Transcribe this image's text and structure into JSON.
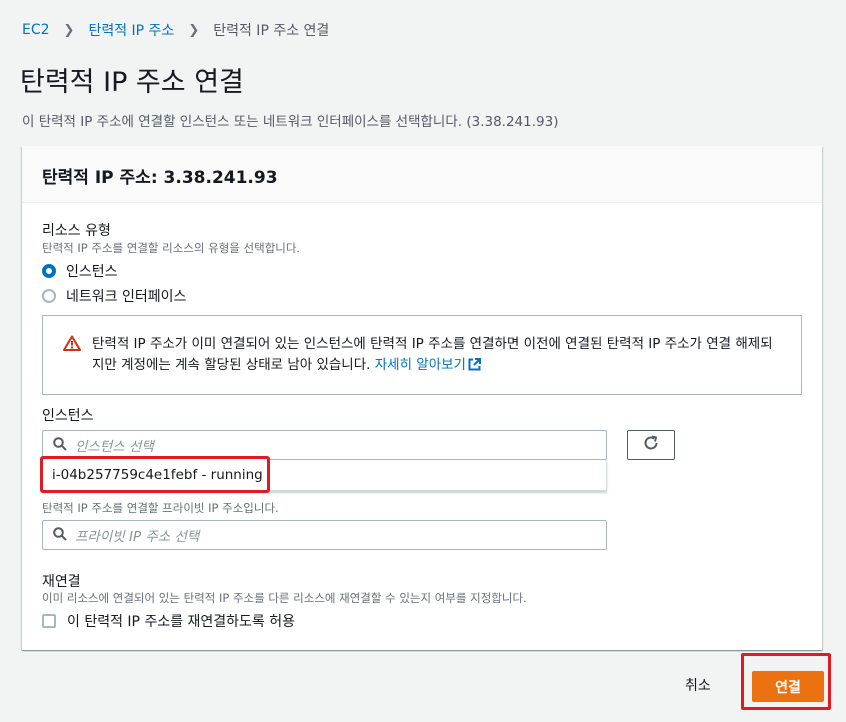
{
  "breadcrumb": {
    "items": [
      "EC2",
      "탄력적 IP 주소",
      "탄력적 IP 주소 연결"
    ]
  },
  "page": {
    "title": "탄력적 IP 주소 연결",
    "description": "이 탄력적 IP 주소에 연결할 인스턴스 또는 네트워크 인터페이스를 선택합니다. (3.38.241.93)"
  },
  "panel": {
    "header": "탄력적 IP 주소: 3.38.241.93",
    "resource_type": {
      "label": "리소스 유형",
      "hint": "탄력적 IP 주소를 연결할 리소스의 유형을 선택합니다.",
      "options": [
        "인스턴스",
        "네트워크 인터페이스"
      ],
      "selected": "인스턴스"
    },
    "alert": {
      "text": "탄력적 IP 주소가 이미 연결되어 있는 인스턴스에 탄력적 IP 주소를 연결하면 이전에 연결된 탄력적 IP 주소가 연결 해제되지만 계정에는 계속 할당된 상태로 남아 있습니다.",
      "link": "자세히 알아보기"
    },
    "instance": {
      "label": "인스턴스",
      "placeholder": "인스턴스 선택",
      "dropdown_option": "i-04b257759c4e1febf - running"
    },
    "private_ip": {
      "hint": "탄력적 IP 주소를 연결할 프라이빗 IP 주소입니다.",
      "placeholder": "프라이빗 IP 주소 선택"
    },
    "reassociate": {
      "label": "재연결",
      "hint": "이미 리소스에 연결되어 있는 탄력적 IP 주소를 다른 리소스에 재연결할 수 있는지 여부를 지정합니다.",
      "checkbox_label": "이 탄력적 IP 주소를 재연결하도록 허용",
      "checked": false
    }
  },
  "footer": {
    "cancel": "취소",
    "connect": "연결"
  },
  "colors": {
    "primary": "#ec7211",
    "link": "#0073bb",
    "highlight": "#e01b24",
    "warning": "#d13212"
  }
}
